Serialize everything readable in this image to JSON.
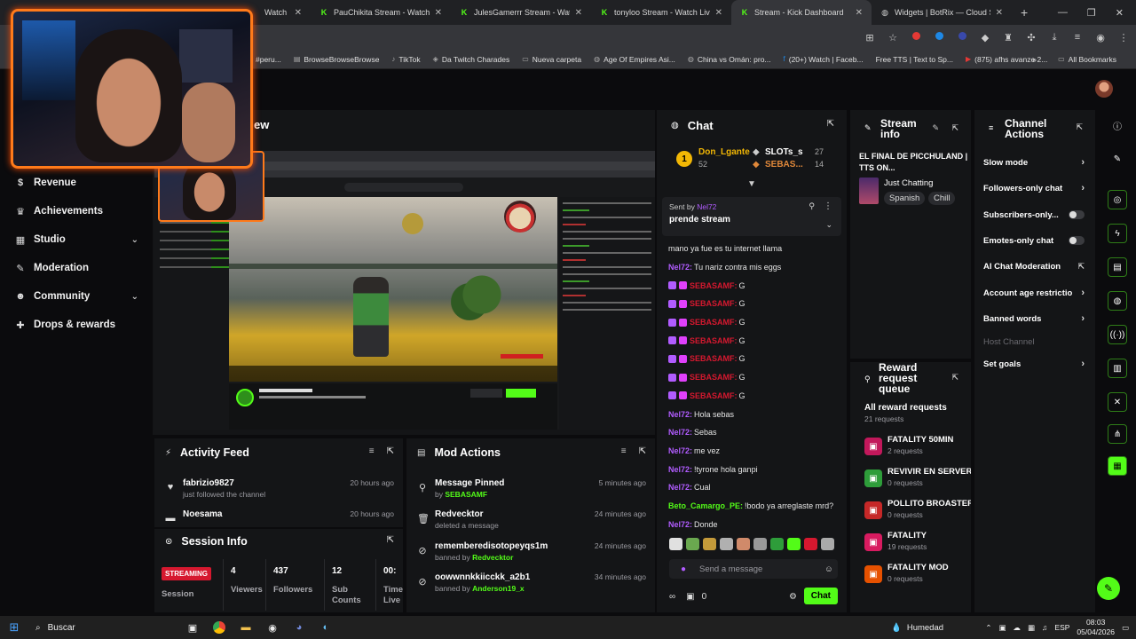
{
  "browser": {
    "tabs": [
      {
        "title": "Watch Liv",
        "active": false
      },
      {
        "title": "PauChikita Stream - Watch Live",
        "active": false
      },
      {
        "title": "JulesGamerrr Stream - Watch Li",
        "active": false
      },
      {
        "title": "tonyloo Stream - Watch Live",
        "active": false
      },
      {
        "title": "Stream - Kick Dashboard",
        "active": true
      },
      {
        "title": "Widgets | BotRix — Cloud Strea",
        "active": false
      }
    ],
    "bookmarks": [
      "#peru...",
      "BrowseBrowseBrowse",
      "TikTok",
      "Da Twitch Charades",
      "Nueva carpeta",
      "Age Of Empires Asi...",
      "China vs Omán: pro...",
      "(20+) Watch | Faceb...",
      "Free TTS | Text to Sp...",
      "(875) afhs avanze 2..."
    ],
    "bookmarks_more": "»",
    "all_bookmarks": "All Bookmarks"
  },
  "nav": {
    "items": [
      {
        "label": "Revenue",
        "icon": "dollar-icon",
        "glyph": "$",
        "has_chevron": false
      },
      {
        "label": "Achievements",
        "icon": "trophy-icon",
        "glyph": "♛",
        "has_chevron": false
      },
      {
        "label": "Studio",
        "icon": "studio-icon",
        "glyph": "▦",
        "has_chevron": true
      },
      {
        "label": "Moderation",
        "icon": "wrench-icon",
        "glyph": "✎",
        "has_chevron": false
      },
      {
        "label": "Community",
        "icon": "people-icon",
        "glyph": "☻",
        "has_chevron": true
      },
      {
        "label": "Drops & rewards",
        "icon": "gift-icon",
        "glyph": "✚",
        "has_chevron": false
      }
    ]
  },
  "preview": {
    "title_fragment": "ew"
  },
  "activity_feed": {
    "title": "Activity Feed",
    "items": [
      {
        "name": "fabrizio9827",
        "sub": "just followed the channel",
        "time": "20 hours ago",
        "icon": "heart-icon",
        "glyph": "♥"
      },
      {
        "name": "Noesama",
        "sub": "",
        "time": "20 hours ago",
        "icon": "sub-icon",
        "glyph": "▬"
      }
    ]
  },
  "mod_actions": {
    "title": "Mod Actions",
    "items": [
      {
        "title": "Message Pinned",
        "sub_prefix": "by ",
        "sub_user": "SEBASAMF",
        "time": "5 minutes ago",
        "icon": "pin-icon",
        "glyph": "⚲"
      },
      {
        "title": "Redvecktor",
        "sub_prefix": "deleted a message",
        "sub_user": "",
        "time": "24 minutes ago",
        "icon": "trash-icon",
        "glyph": "🗑"
      },
      {
        "title": "rememberedisotopeyqs1m",
        "sub_prefix": "banned by ",
        "sub_user": "Redvecktor",
        "time": "24 minutes ago",
        "icon": "ban-icon",
        "glyph": "⊘"
      },
      {
        "title": "oowwnnkkiicckk_a2b1",
        "sub_prefix": "banned by ",
        "sub_user": "Anderson19_x",
        "time": "34 minutes ago",
        "icon": "ban-icon",
        "glyph": "⊘"
      }
    ]
  },
  "session_info": {
    "title": "Session Info",
    "status": "STREAMING",
    "status_label": "Session",
    "stats": [
      {
        "value": "4",
        "label": "Viewers"
      },
      {
        "value": "437",
        "label": "Followers"
      },
      {
        "value": "12",
        "label": "Sub Counts"
      },
      {
        "value": "00:",
        "label": "Time Live"
      }
    ]
  },
  "chat": {
    "title": "Chat",
    "leaderboard": [
      {
        "name": "Don_Lgante",
        "value": "52",
        "rank": "1"
      },
      {
        "name": "SLOTs_s",
        "value": "27"
      },
      {
        "name": "SEBAS...",
        "value": "14"
      }
    ],
    "pinned": {
      "sent_by_label": "Sent by",
      "sent_by_user": "Nel72",
      "message": "prende stream"
    },
    "messages": [
      {
        "user": "",
        "text": "mano ya fue es tu internet llama",
        "color": "#e6e6e6",
        "badges": false
      },
      {
        "user": "Nel72:",
        "text": "Tu nariz contra mis eggs",
        "color": "#b15cff",
        "badges": false
      },
      {
        "user": "SEBASAMF:",
        "text": "G",
        "color": "#d6182f",
        "badges": true
      },
      {
        "user": "SEBASAMF:",
        "text": "G",
        "color": "#d6182f",
        "badges": true
      },
      {
        "user": "SEBASAMF:",
        "text": "G",
        "color": "#d6182f",
        "badges": true
      },
      {
        "user": "SEBASAMF:",
        "text": "G",
        "color": "#d6182f",
        "badges": true
      },
      {
        "user": "SEBASAMF:",
        "text": "G",
        "color": "#d6182f",
        "badges": true
      },
      {
        "user": "SEBASAMF:",
        "text": "G",
        "color": "#d6182f",
        "badges": true
      },
      {
        "user": "SEBASAMF:",
        "text": "G",
        "color": "#d6182f",
        "badges": true
      },
      {
        "user": "Nel72:",
        "text": "Hola sebas",
        "color": "#b15cff",
        "badges": false
      },
      {
        "user": "Nel72:",
        "text": "Sebas",
        "color": "#b15cff",
        "badges": false
      },
      {
        "user": "Nel72:",
        "text": "me vez",
        "color": "#b15cff",
        "badges": false
      },
      {
        "user": "Nel72:",
        "text": "!tyrone hola ganpi",
        "color": "#b15cff",
        "badges": false
      },
      {
        "user": "Nel72:",
        "text": "Cual",
        "color": "#b15cff",
        "badges": false
      },
      {
        "user": "Beto_Camargo_PE:",
        "text": "!bodo ya arreglaste mrd?",
        "color": "#53fc18",
        "badges": false
      },
      {
        "user": "Nel72:",
        "text": "Donde",
        "color": "#b15cff",
        "badges": false
      }
    ],
    "input_placeholder": "Send a message",
    "points": "0",
    "send_label": "Chat"
  },
  "stream_info": {
    "title": "Stream info",
    "stream_title": "EL FINAL DE PICCHULAND | TTS ON...",
    "category": "Just Chatting",
    "tags": [
      "Spanish",
      "Chill"
    ]
  },
  "reward_queue": {
    "title": "Reward request queue",
    "all_label": "All reward requests",
    "all_count": "21 requests",
    "rewards": [
      {
        "name": "FATALITY 50MIN",
        "count": "2 requests",
        "color": "#c2185b"
      },
      {
        "name": "REVIVIR EN SERVER ...",
        "count": "0 requests",
        "color": "#2e9d3a"
      },
      {
        "name": "POLLITO BROASTER",
        "count": "0 requests",
        "color": "#c62828"
      },
      {
        "name": "FATALITY",
        "count": "19 requests",
        "color": "#d81b60"
      },
      {
        "name": "FATALITY MOD",
        "count": "0 requests",
        "color": "#e65100"
      }
    ]
  },
  "channel_actions": {
    "title": "Channel Actions",
    "items": [
      {
        "label": "Slow mode",
        "control": "chevron"
      },
      {
        "label": "Followers-only chat",
        "control": "chevron"
      },
      {
        "label": "Subscribers-only...",
        "control": "toggle"
      },
      {
        "label": "Emotes-only chat",
        "control": "toggle"
      },
      {
        "label": "AI Chat Moderation",
        "control": "external"
      },
      {
        "label": "Account age restrictio",
        "control": "chevron"
      },
      {
        "label": "Banned words",
        "control": "chevron"
      },
      {
        "label": "Host Channel",
        "control": "none"
      },
      {
        "label": "Set goals",
        "control": "chevron"
      }
    ]
  },
  "taskbar": {
    "search": "Buscar",
    "weather": "Humedad",
    "lang": "ESP",
    "time": "08:03",
    "date": "05/04/2026"
  }
}
